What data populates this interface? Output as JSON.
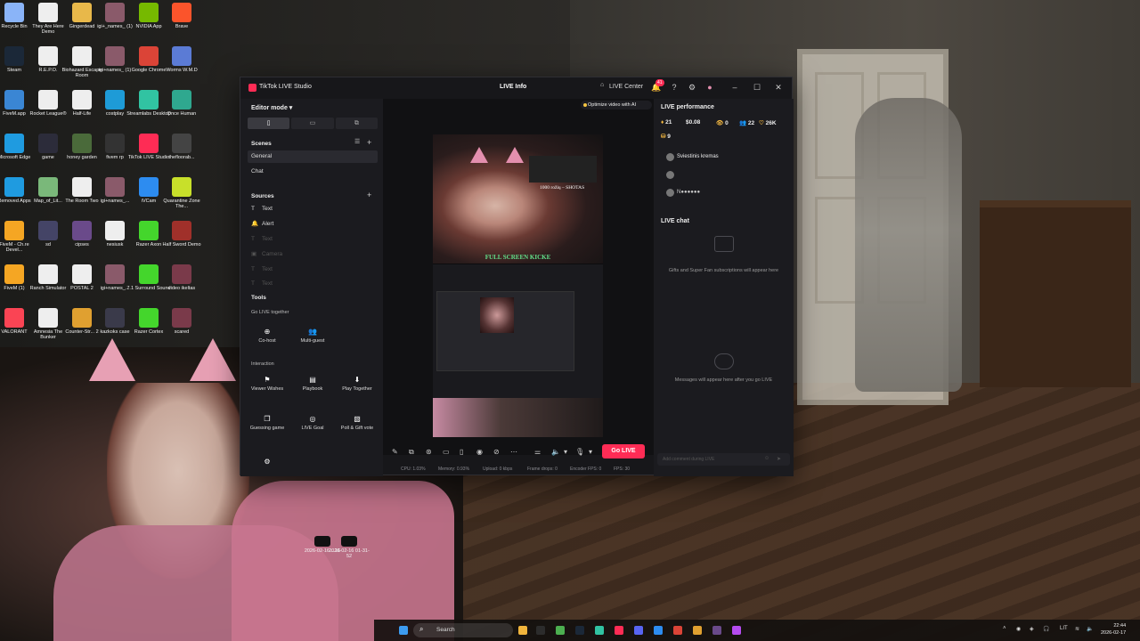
{
  "desktop": {
    "icons": [
      {
        "label": "Recycle Bin",
        "color": "#8ab4f8"
      },
      {
        "label": "They Are Here Demo",
        "color": "#eeeeee"
      },
      {
        "label": "Gingerdead",
        "color": "#e8b84a"
      },
      {
        "label": "igi+_names_ (1)",
        "color": "#8a5a6a"
      },
      {
        "label": "NVIDIA App",
        "color": "#76b900"
      },
      {
        "label": "Brave",
        "color": "#fb542b"
      },
      {
        "label": "Steam",
        "color": "#1b2838"
      },
      {
        "label": "R.E.P.O.",
        "color": "#eeeeee"
      },
      {
        "label": "Biohazard Escape Room",
        "color": "#eeeeee"
      },
      {
        "label": "igi+names_ (1)",
        "color": "#8a5a6a"
      },
      {
        "label": "Google Chrome",
        "color": "#db4437"
      },
      {
        "label": "Worms W.M.D",
        "color": "#5b7bd5"
      },
      {
        "label": "FiveM.app",
        "color": "#3a86d4"
      },
      {
        "label": "Rocket League®",
        "color": "#eeeeee"
      },
      {
        "label": "Half-Life",
        "color": "#eeeeee"
      },
      {
        "label": "costplay",
        "color": "#1e9bd7"
      },
      {
        "label": "Streamlabs Desktop",
        "color": "#31c3a2"
      },
      {
        "label": "Once Human",
        "color": "#2fa88f"
      },
      {
        "label": "Microsoft Edge",
        "color": "#1f9be0"
      },
      {
        "label": "game",
        "color": "#2c2c3a"
      },
      {
        "label": "honey garden",
        "color": "#4a6a3a"
      },
      {
        "label": "fivem rp",
        "color": "#333333"
      },
      {
        "label": "TikTok LIVE Studio",
        "color": "#fe2c55"
      },
      {
        "label": "thefloorab...",
        "color": "#444444"
      },
      {
        "label": "Removed Apps",
        "color": "#1f9be0"
      },
      {
        "label": "Map_of_Lit...",
        "color": "#7ab87a"
      },
      {
        "label": "The Room Two",
        "color": "#eeeeee"
      },
      {
        "label": "igi+names_...",
        "color": "#8a5a6a"
      },
      {
        "label": "iVCam",
        "color": "#2d8cf0"
      },
      {
        "label": "Quarantine Zone The...",
        "color": "#c8e02a"
      },
      {
        "label": "FiveM - Ch.re Devel...",
        "color": "#f5a623"
      },
      {
        "label": "sd",
        "color": "#444466"
      },
      {
        "label": "cipses",
        "color": "#6a4a8a"
      },
      {
        "label": "nesiusk",
        "color": "#eeeeee"
      },
      {
        "label": "Razer Axon",
        "color": "#44d62c"
      },
      {
        "label": "Half Sword Demo",
        "color": "#a0302a"
      },
      {
        "label": "FiveM (1)",
        "color": "#f5a623"
      },
      {
        "label": "Ranch Simulator",
        "color": "#eeeeee"
      },
      {
        "label": "POSTAL 2",
        "color": "#eeeeee"
      },
      {
        "label": "igi+names_...",
        "color": "#8a5a6a"
      },
      {
        "label": "7.1 Surround Sound",
        "color": "#44d62c"
      },
      {
        "label": "video ikeltas",
        "color": "#7a3a4a"
      },
      {
        "label": "VALORANT",
        "color": "#fa4454"
      },
      {
        "label": "Amnesia The Bunker",
        "color": "#eeeeee"
      },
      {
        "label": "Counter-Str... 2",
        "color": "#e0a030"
      },
      {
        "label": "kazkoks case",
        "color": "#3a3a4a"
      },
      {
        "label": "Razer Cortex",
        "color": "#44d62c"
      },
      {
        "label": "scared",
        "color": "#7a3a4a"
      }
    ],
    "file_thumbs": [
      {
        "label": "2026-02-16 ...16"
      },
      {
        "label": "2026-02-16 01-31-52"
      }
    ]
  },
  "window": {
    "app_title": "TikTok LIVE Studio",
    "center_title": "LIVE Info",
    "live_center": "LIVE Center",
    "notif_count": "41",
    "optimize": "Optimize video with AI"
  },
  "left_panel": {
    "editor_mode": "Editor mode",
    "orientation_icons": [
      "▯",
      "▭",
      "⧉"
    ],
    "scenes_title": "Scenes",
    "scenes": [
      "General",
      "Chat"
    ],
    "sources_title": "Sources",
    "sources": [
      {
        "label": "Text",
        "icon": "T"
      },
      {
        "label": "Alert",
        "icon": "🔔"
      },
      {
        "label": "Text",
        "icon": "T"
      },
      {
        "label": "Camera",
        "icon": "▣"
      },
      {
        "label": "Text",
        "icon": "T"
      },
      {
        "label": "Text",
        "icon": "T"
      }
    ],
    "tools_title": "Tools",
    "go_live_together": "Go LIVE together",
    "interaction": "Interaction",
    "tools_golive": [
      {
        "label": "Co-host",
        "icon": "⊕"
      },
      {
        "label": "Multi-guest",
        "icon": "👥"
      }
    ],
    "tools_interaction": [
      {
        "label": "Viewer Wishes",
        "icon": "⚑"
      },
      {
        "label": "Playbook",
        "icon": "▤"
      },
      {
        "label": "Play Together",
        "icon": "⬇"
      },
      {
        "label": "Guessing game",
        "icon": "❐"
      },
      {
        "label": "LIVE Goal",
        "icon": "◎"
      },
      {
        "label": "Poll & Gift vote",
        "icon": "▧"
      }
    ]
  },
  "preview": {
    "nickname": "1000 rožių – SHOTAS",
    "banner": "FULL SCREEN KICKE"
  },
  "controls": {
    "go_live": "Go LIVE",
    "stats": {
      "cpu": "CPU: 1.03%",
      "memory": "Memory: 0.93%",
      "upload": "Upload: 0 kbps",
      "frame_drops": "Frame drops: 0",
      "encoder_fps": "Encoder FPS: 0",
      "fps": "FPS: 30"
    }
  },
  "right_panel": {
    "performance_title": "LIVE performance",
    "metrics": [
      "21",
      "$0.08",
      "0",
      "22",
      "26K",
      "9"
    ],
    "guests": [
      "Sviestinis kremas",
      "",
      ""
    ],
    "chat_title": "LIVE chat",
    "gifts_empty": "Gifts and Super Fan subscriptions will appear here",
    "messages_empty": "Messages will appear here after you go LIVE",
    "chat_placeholder": "Add comment during LIVE"
  },
  "taskbar": {
    "search": "Search",
    "lang": "LIT",
    "time": "22:44",
    "date": "2026-02-17",
    "apps": [
      "#f0b43c",
      "#2c2c2c",
      "#4caf50",
      "#1b2838",
      "#31c3a2",
      "#fe2c55",
      "#5865f2",
      "#2d8cf0",
      "#db4437",
      "#e0a030",
      "#6a4a8a",
      "#b54cf0"
    ]
  },
  "colors": {
    "accent": "#fe2c55",
    "panel": "#1b1b1f"
  }
}
